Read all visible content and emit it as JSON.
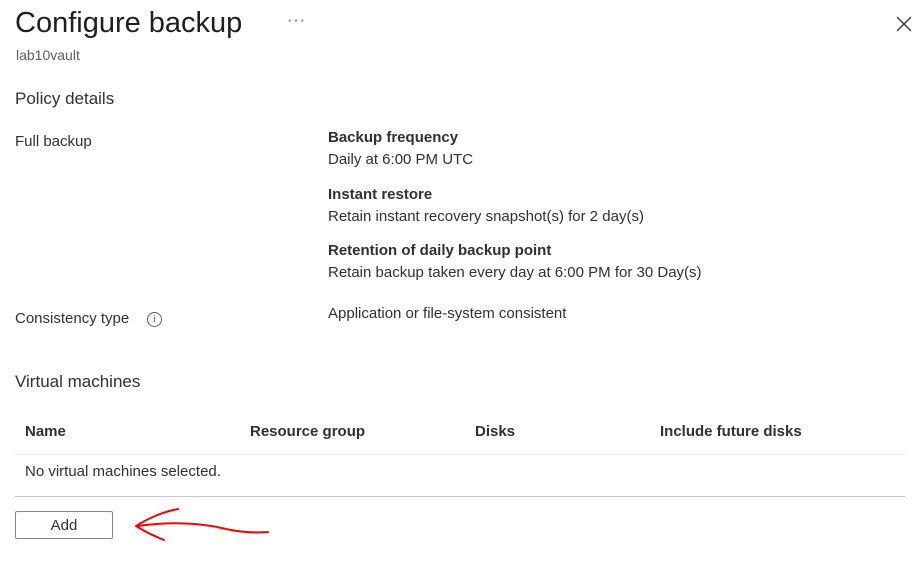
{
  "header": {
    "title": "Configure backup",
    "more_label": "···",
    "subtitle": "lab10vault"
  },
  "policy": {
    "heading": "Policy details",
    "full_backup_label": "Full backup",
    "frequency_title": "Backup frequency",
    "frequency_value": "Daily at 6:00 PM UTC",
    "instant_title": "Instant restore",
    "instant_value": "Retain instant recovery snapshot(s) for 2 day(s)",
    "retention_title": "Retention of daily backup point",
    "retention_value": "Retain backup taken every day at 6:00 PM for 30 Day(s)",
    "consistency_label": "Consistency type",
    "consistency_value": "Application or file-system consistent"
  },
  "vms": {
    "heading": "Virtual machines",
    "columns": [
      "Name",
      "Resource group",
      "Disks",
      "Include future disks"
    ],
    "empty_text": "No virtual machines selected.",
    "add_label": "Add"
  },
  "icons": {
    "more": "more-icon",
    "close": "close-icon",
    "info": "info-icon"
  },
  "colors": {
    "annotation": "#ff0000"
  }
}
